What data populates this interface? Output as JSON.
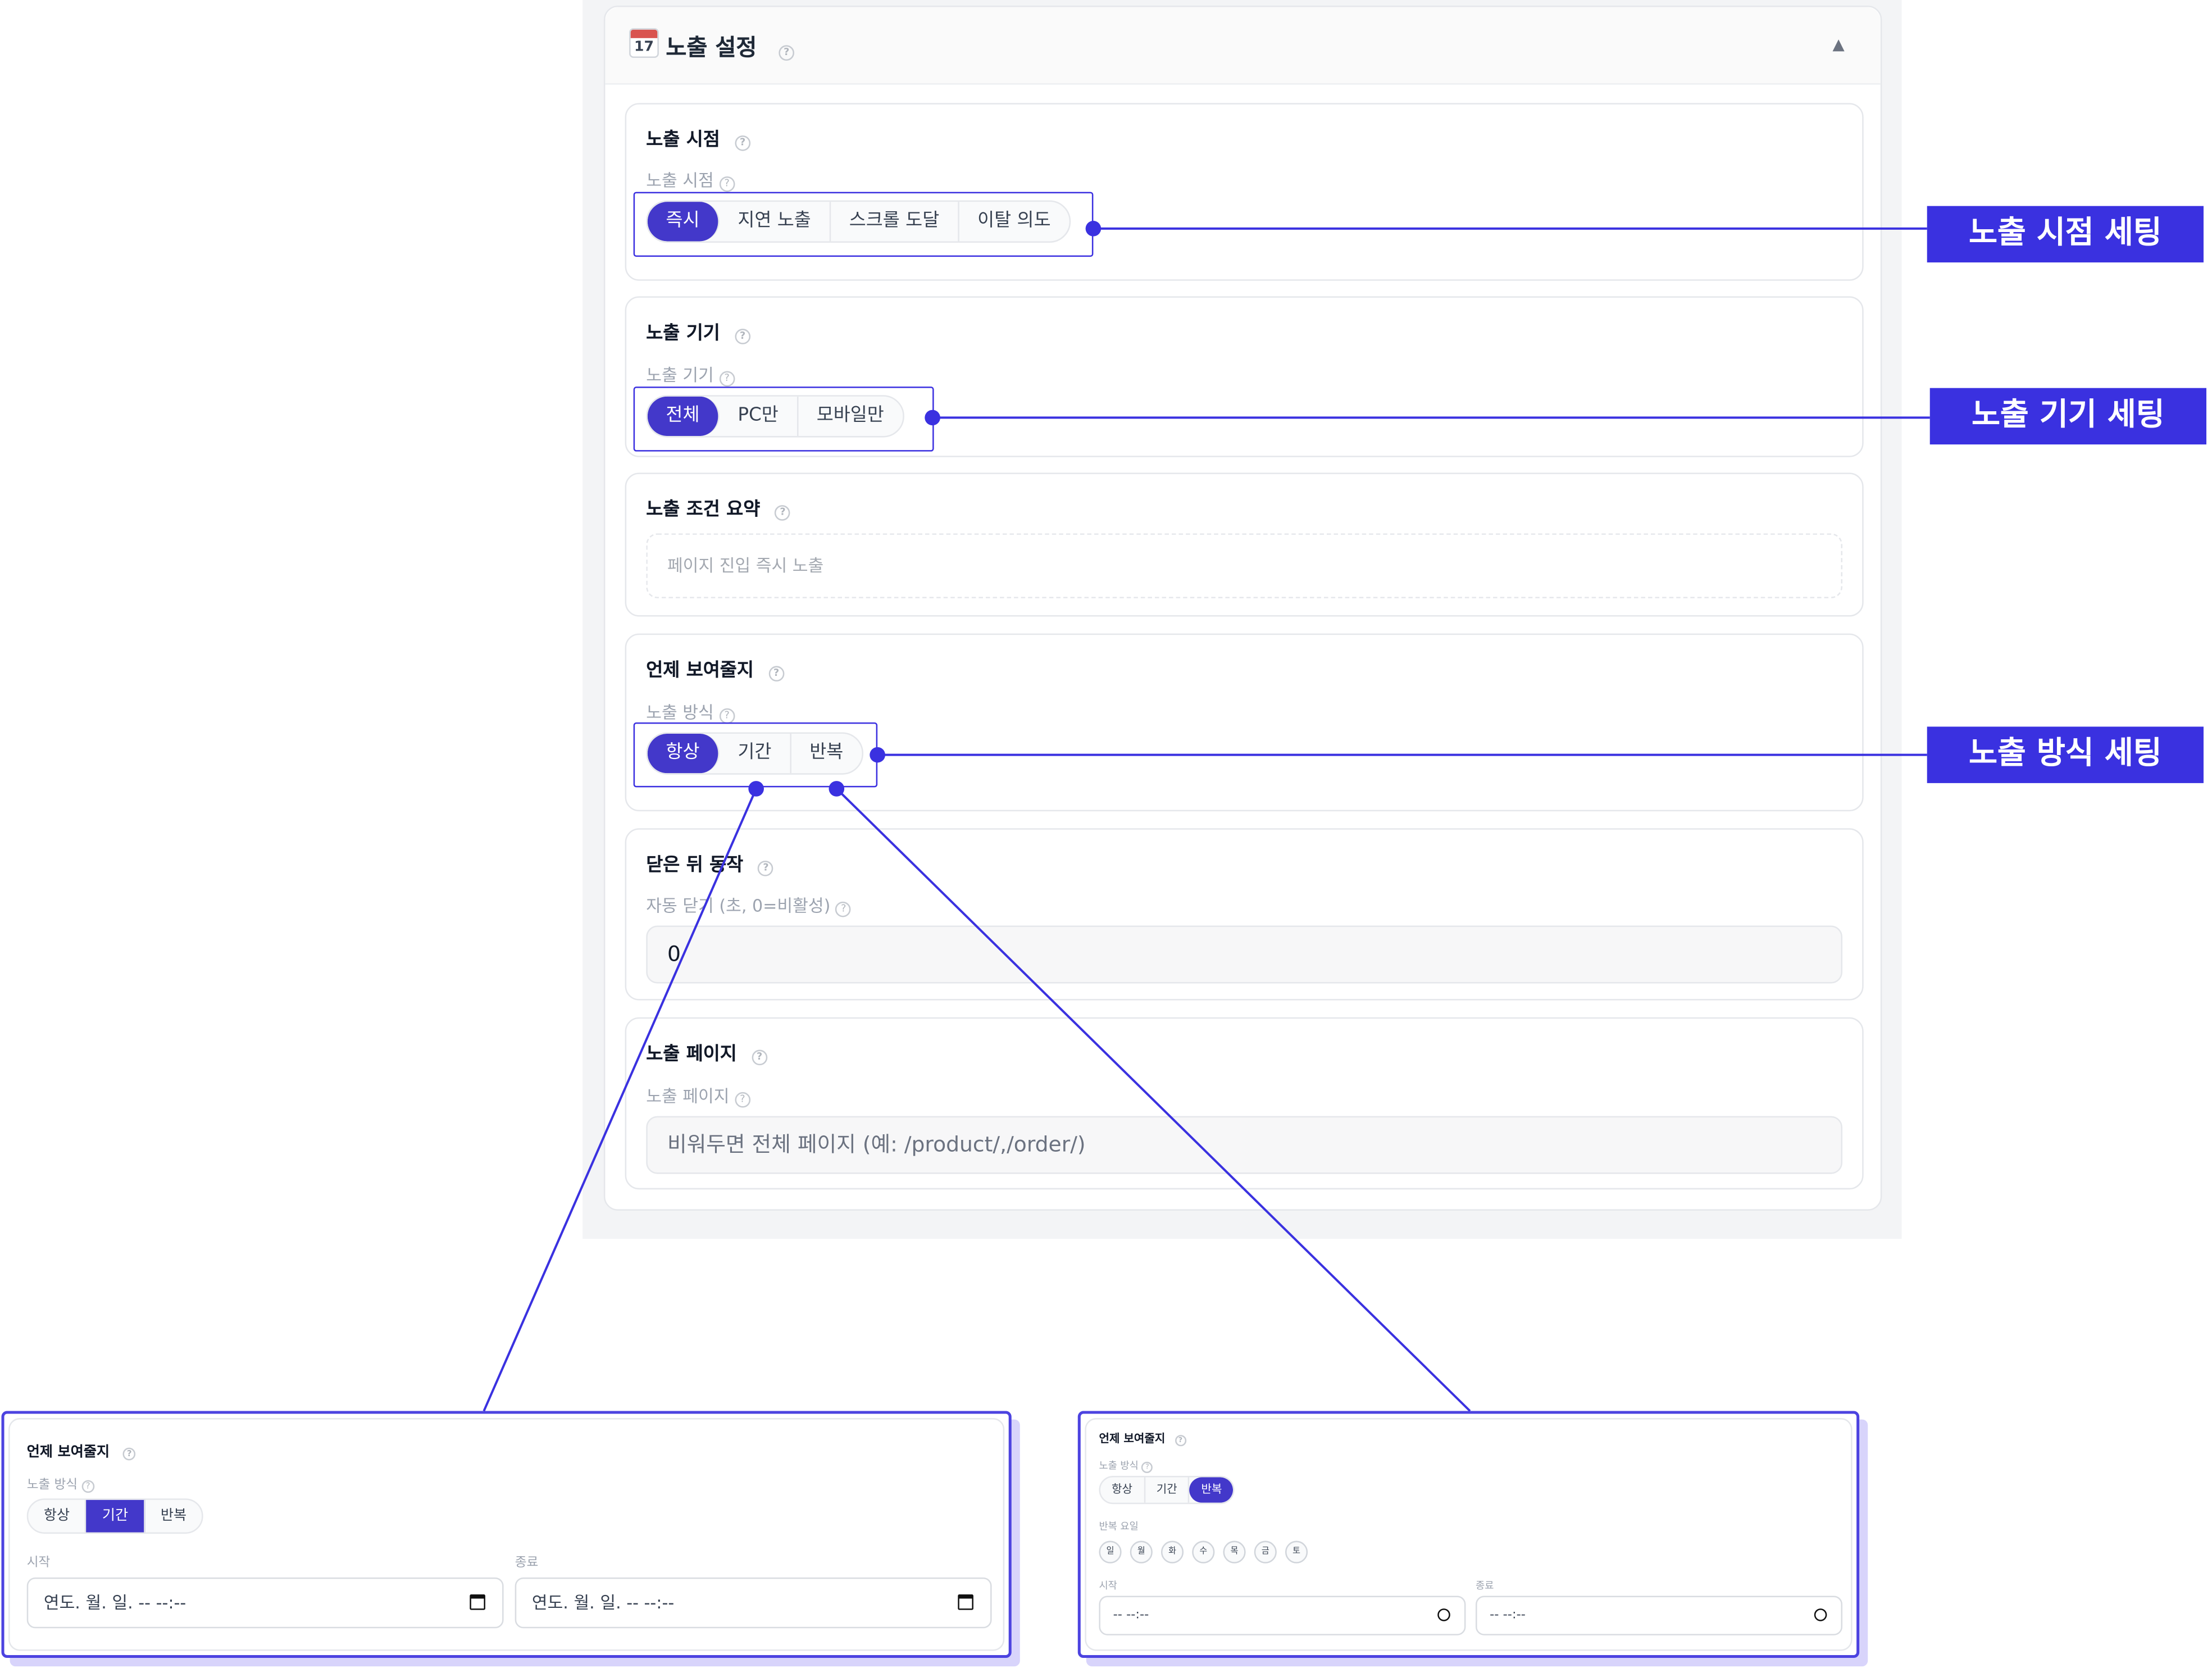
{
  "panel": {
    "icon_day": "17",
    "title": "노출 설정",
    "collapse_icon": "▲"
  },
  "timing": {
    "title": "노출 시점",
    "sub_label": "노출 시점",
    "options": [
      "즉시",
      "지연 노출",
      "스크롤 도달",
      "이탈 의도"
    ],
    "selected": "즉시"
  },
  "device": {
    "title": "노출 기기",
    "sub_label": "노출 기기",
    "options": [
      "전체",
      "PC만",
      "모바일만"
    ],
    "selected": "전체"
  },
  "summary": {
    "title": "노출 조건 요약",
    "text": "페이지 진입 즉시 노출"
  },
  "when": {
    "title": "언제 보여줄지",
    "sub_label": "노출 방식",
    "options": [
      "항상",
      "기간",
      "반복"
    ],
    "selected": "항상"
  },
  "after_close": {
    "title": "닫은 뒤 동작",
    "sub_label": "자동 닫기 (초, 0=비활성)",
    "value": "0"
  },
  "pages": {
    "title": "노출 페이지",
    "sub_label": "노출 페이지",
    "placeholder": "비워두면 전체 페이지 (예: /product/,/order/)"
  },
  "annotations": {
    "timing_tag": "노출 시점 세팅",
    "device_tag": "노출 기기 세팅",
    "mode_tag": "노출 방식 세팅"
  },
  "zoom_period": {
    "title": "언제 보여줄지",
    "sub_label": "노출 방식",
    "options": [
      "항상",
      "기간",
      "반복"
    ],
    "selected": "기간",
    "start_label": "시작",
    "end_label": "종료",
    "start_value": "연도. 월. 일. -- --:--",
    "end_value": "연도. 월. 일. -- --:--"
  },
  "zoom_repeat": {
    "title": "언제 보여줄지",
    "sub_label": "노출 방식",
    "options": [
      "항상",
      "기간",
      "반복"
    ],
    "selected": "반복",
    "days_label": "반복 요일",
    "days": [
      "일",
      "월",
      "화",
      "수",
      "목",
      "금",
      "토"
    ],
    "start_label": "시작",
    "end_label": "종료",
    "start_value": "-- --:--",
    "end_value": "-- --:--"
  },
  "colors": {
    "accent": "#4338ca",
    "annotation": "#3a31e0"
  }
}
